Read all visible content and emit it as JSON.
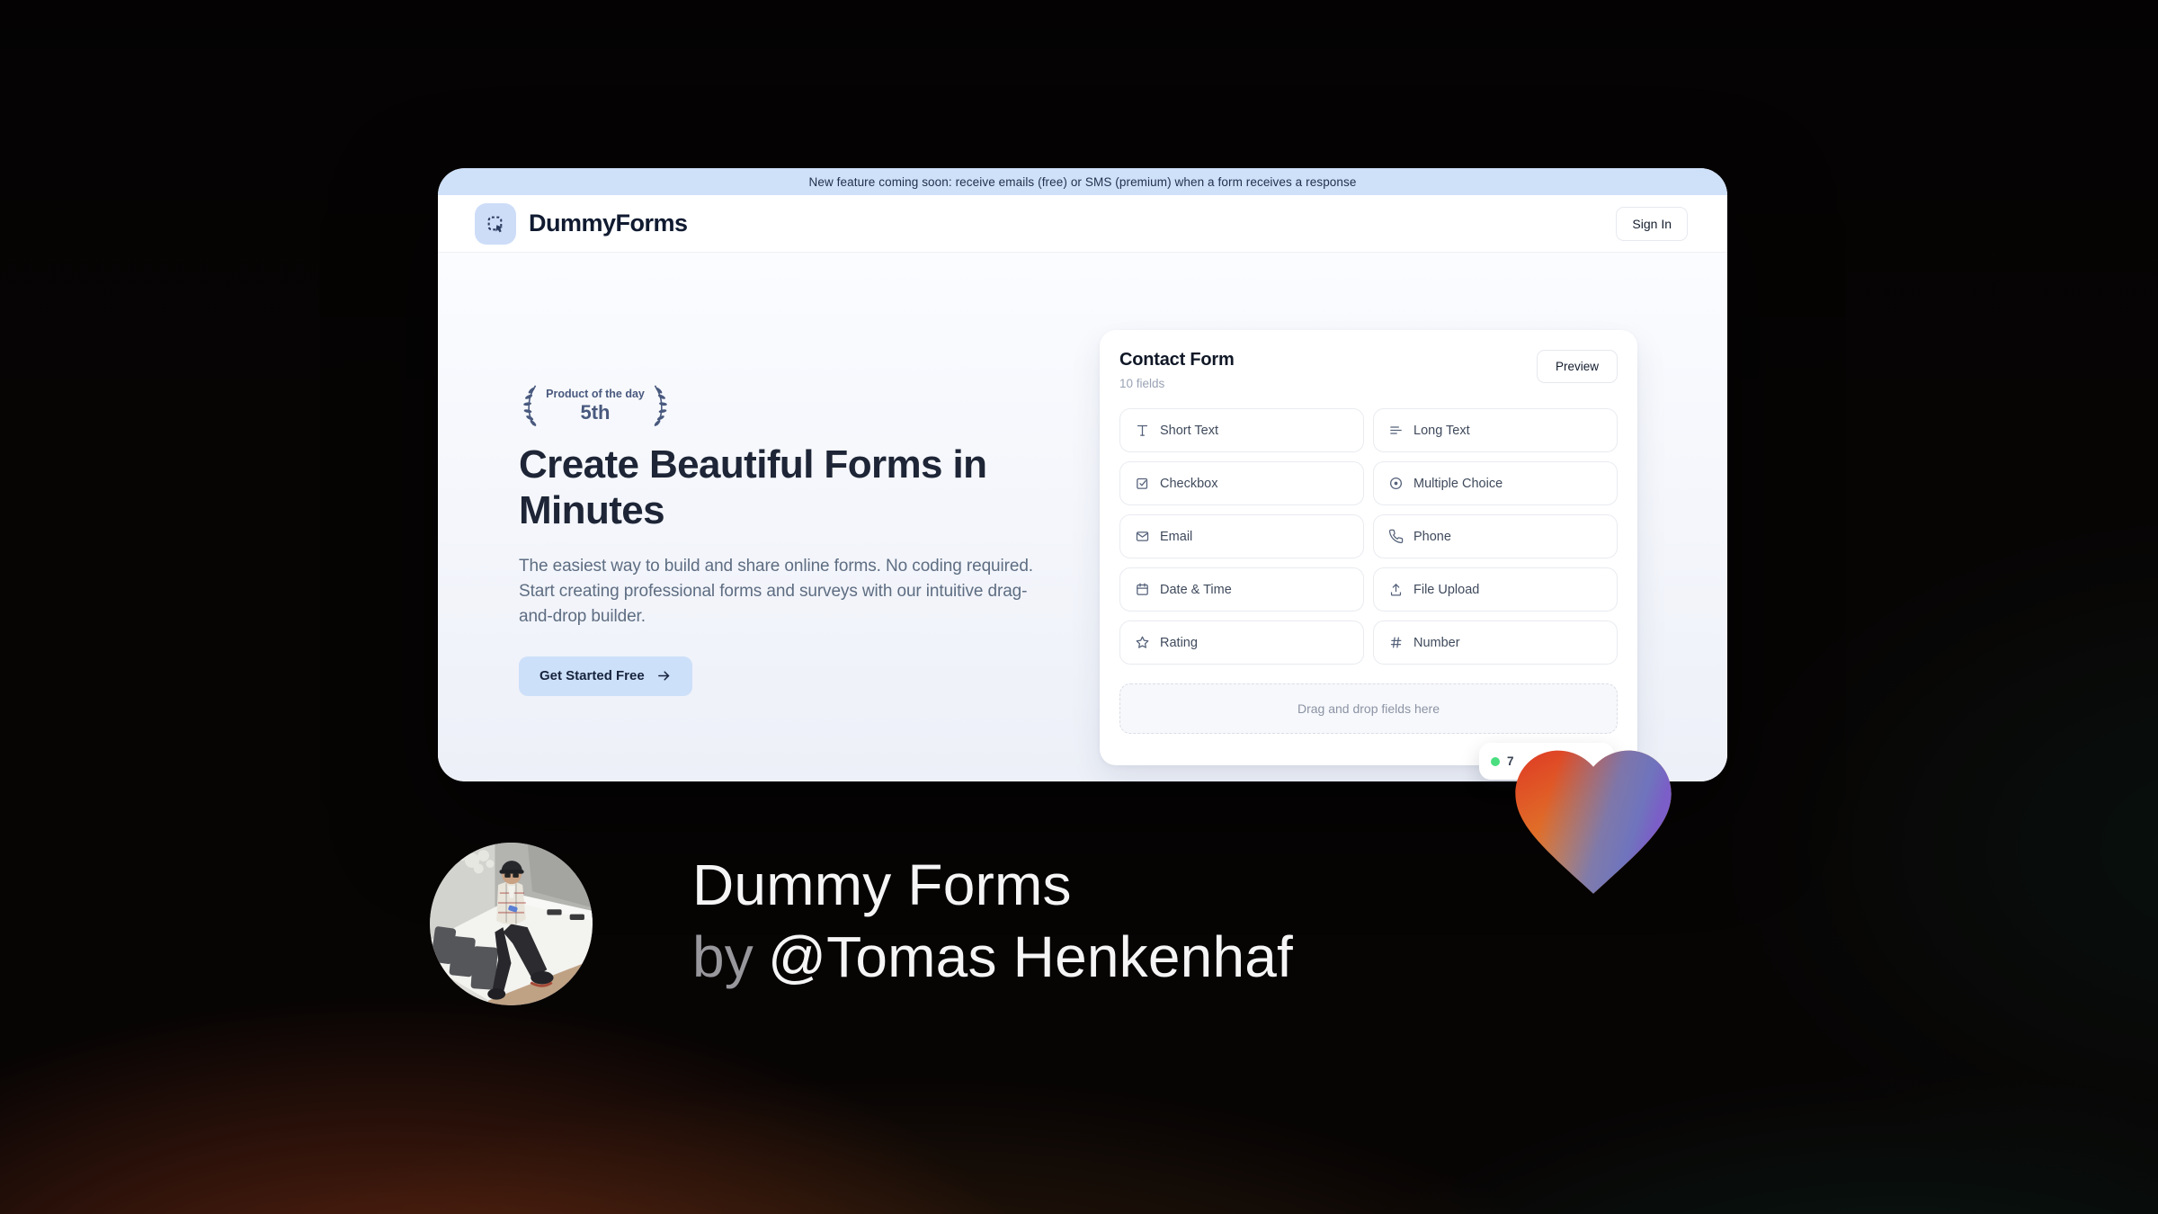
{
  "banner": {
    "text": "New feature coming soon: receive emails (free) or SMS (premium) when a form receives a response"
  },
  "header": {
    "brand": "DummyForms",
    "sign_in": "Sign In"
  },
  "hero": {
    "badge": {
      "line1": "Product of the day",
      "line2": "5th"
    },
    "title": "Create Beautiful Forms in Minutes",
    "description": "The easiest way to build and share online forms. No coding required. Start creating professional forms and surveys with our intuitive drag-and-drop builder.",
    "cta": "Get Started Free"
  },
  "form_card": {
    "title": "Contact Form",
    "subtitle": "10 fields",
    "preview": "Preview",
    "fields": [
      {
        "label": "Short Text",
        "icon": "short-text-icon"
      },
      {
        "label": "Long Text",
        "icon": "long-text-icon"
      },
      {
        "label": "Checkbox",
        "icon": "checkbox-icon"
      },
      {
        "label": "Multiple Choice",
        "icon": "radio-icon"
      },
      {
        "label": "Email",
        "icon": "envelope-icon"
      },
      {
        "label": "Phone",
        "icon": "phone-icon"
      },
      {
        "label": "Date & Time",
        "icon": "calendar-icon"
      },
      {
        "label": "File Upload",
        "icon": "upload-icon"
      },
      {
        "label": "Rating",
        "icon": "star-icon"
      },
      {
        "label": "Number",
        "icon": "hash-icon"
      }
    ],
    "dropzone": "Drag and drop fields here",
    "toast": "7"
  },
  "footer": {
    "product": "Dummy Forms",
    "by": "by",
    "author": "@Tomas Henkenhaf"
  },
  "colors": {
    "accent_blue": "#cfe0f9",
    "brand_navy": "#101b31",
    "laurel_slate": "#49597e",
    "toast_green": "#4ade80",
    "heart_red": "#df3a24",
    "heart_orange": "#f0972e",
    "heart_violet": "#7b5ec7"
  }
}
